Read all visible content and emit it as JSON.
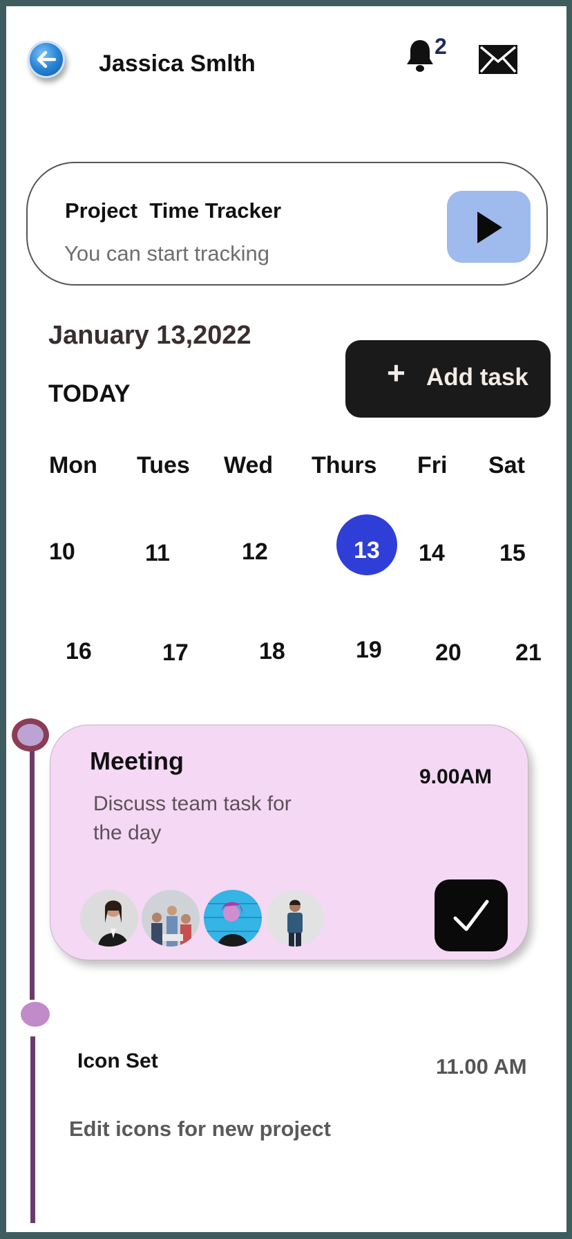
{
  "header": {
    "user_name": "Jassica Smlth",
    "notification_count": "2",
    "icons": [
      "back-arrow-icon",
      "bell-icon",
      "mail-icon"
    ]
  },
  "tracker": {
    "title": "Project  Time Tracker",
    "subtitle": "You can start tracking",
    "play_icon": "play-icon"
  },
  "date": {
    "title": "January 13,2022",
    "today_label": "TODAY",
    "add_task_plus": "+",
    "add_task_label": "Add task"
  },
  "calendar": {
    "days": [
      "Mon",
      "Tues",
      "Wed",
      "Thurs",
      "Fri",
      "Sat"
    ],
    "week1": [
      "10",
      "11",
      "12",
      "13",
      "14",
      "15"
    ],
    "week2": [
      "16",
      "17",
      "18",
      "19",
      "20",
      "21"
    ],
    "selected": "13"
  },
  "tasks": [
    {
      "title": "Meeting",
      "time": "9.00AM",
      "description": "Discuss team task for the day",
      "participants": [
        "participant-1",
        "participant-2",
        "participant-3",
        "participant-4"
      ]
    },
    {
      "title": "Icon Set",
      "time": "11.00 AM",
      "description": "Edit icons for new project"
    }
  ],
  "colors": {
    "frame": "#3f5d5e",
    "selected_day": "#2f3ed6",
    "play_button": "#9fbaec",
    "meeting_card": "#f4d8f4",
    "timeline": "#6b3b6e"
  }
}
